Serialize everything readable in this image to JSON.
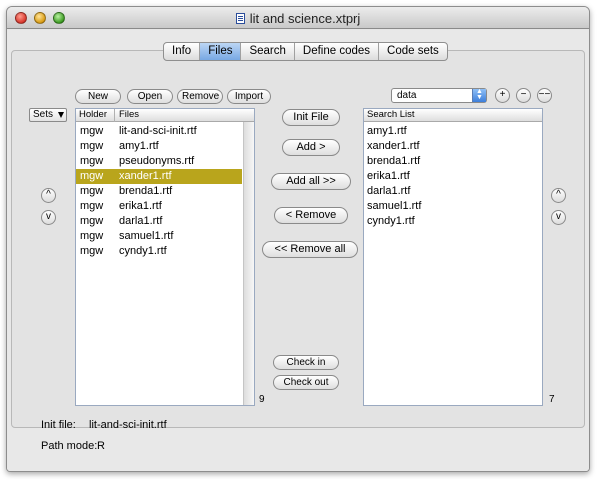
{
  "window": {
    "title": "lit and science.xtprj"
  },
  "tabs": [
    "Info",
    "Files",
    "Search",
    "Define codes",
    "Code sets"
  ],
  "active_tab": "Files",
  "toolbar": {
    "new": "New",
    "open": "Open",
    "remove": "Remove",
    "import": "Import"
  },
  "sets_select": {
    "value": "Sets"
  },
  "left_list": {
    "headers": [
      "Holder",
      "Files"
    ],
    "rows": [
      {
        "holder": "mgw",
        "file": "lit-and-sci-init.rtf"
      },
      {
        "holder": "mgw",
        "file": "amy1.rtf"
      },
      {
        "holder": "mgw",
        "file": "pseudonyms.rtf"
      },
      {
        "holder": "mgw",
        "file": "xander1.rtf"
      },
      {
        "holder": "mgw",
        "file": "brenda1.rtf"
      },
      {
        "holder": "mgw",
        "file": "erika1.rtf"
      },
      {
        "holder": "mgw",
        "file": "darla1.rtf"
      },
      {
        "holder": "mgw",
        "file": "samuel1.rtf"
      },
      {
        "holder": "mgw",
        "file": "cyndy1.rtf"
      }
    ],
    "selected_index": 3,
    "count": "9"
  },
  "middle_buttons": {
    "init_file": "Init File",
    "add": "Add >",
    "add_all": "Add all >>",
    "remove": "< Remove",
    "remove_all": "<< Remove all",
    "check_in": "Check in",
    "check_out": "Check out"
  },
  "data_select": {
    "value": "data"
  },
  "round_buttons": {
    "plus": "+",
    "minus": "−",
    "minus2": "−−",
    "up": "^",
    "down": "v"
  },
  "search_list": {
    "header": "Search List",
    "items": [
      "amy1.rtf",
      "xander1.rtf",
      "brenda1.rtf",
      "erika1.rtf",
      "darla1.rtf",
      "samuel1.rtf",
      "cyndy1.rtf"
    ],
    "count": "7"
  },
  "footer": {
    "init_file_label": "Init file:",
    "init_file_value": "lit-and-sci-init.rtf",
    "path_mode_label": "Path mode:",
    "path_mode_value": "R"
  },
  "colors": {
    "selection": "#b9a51c",
    "active_tab": "#78a8e4"
  }
}
